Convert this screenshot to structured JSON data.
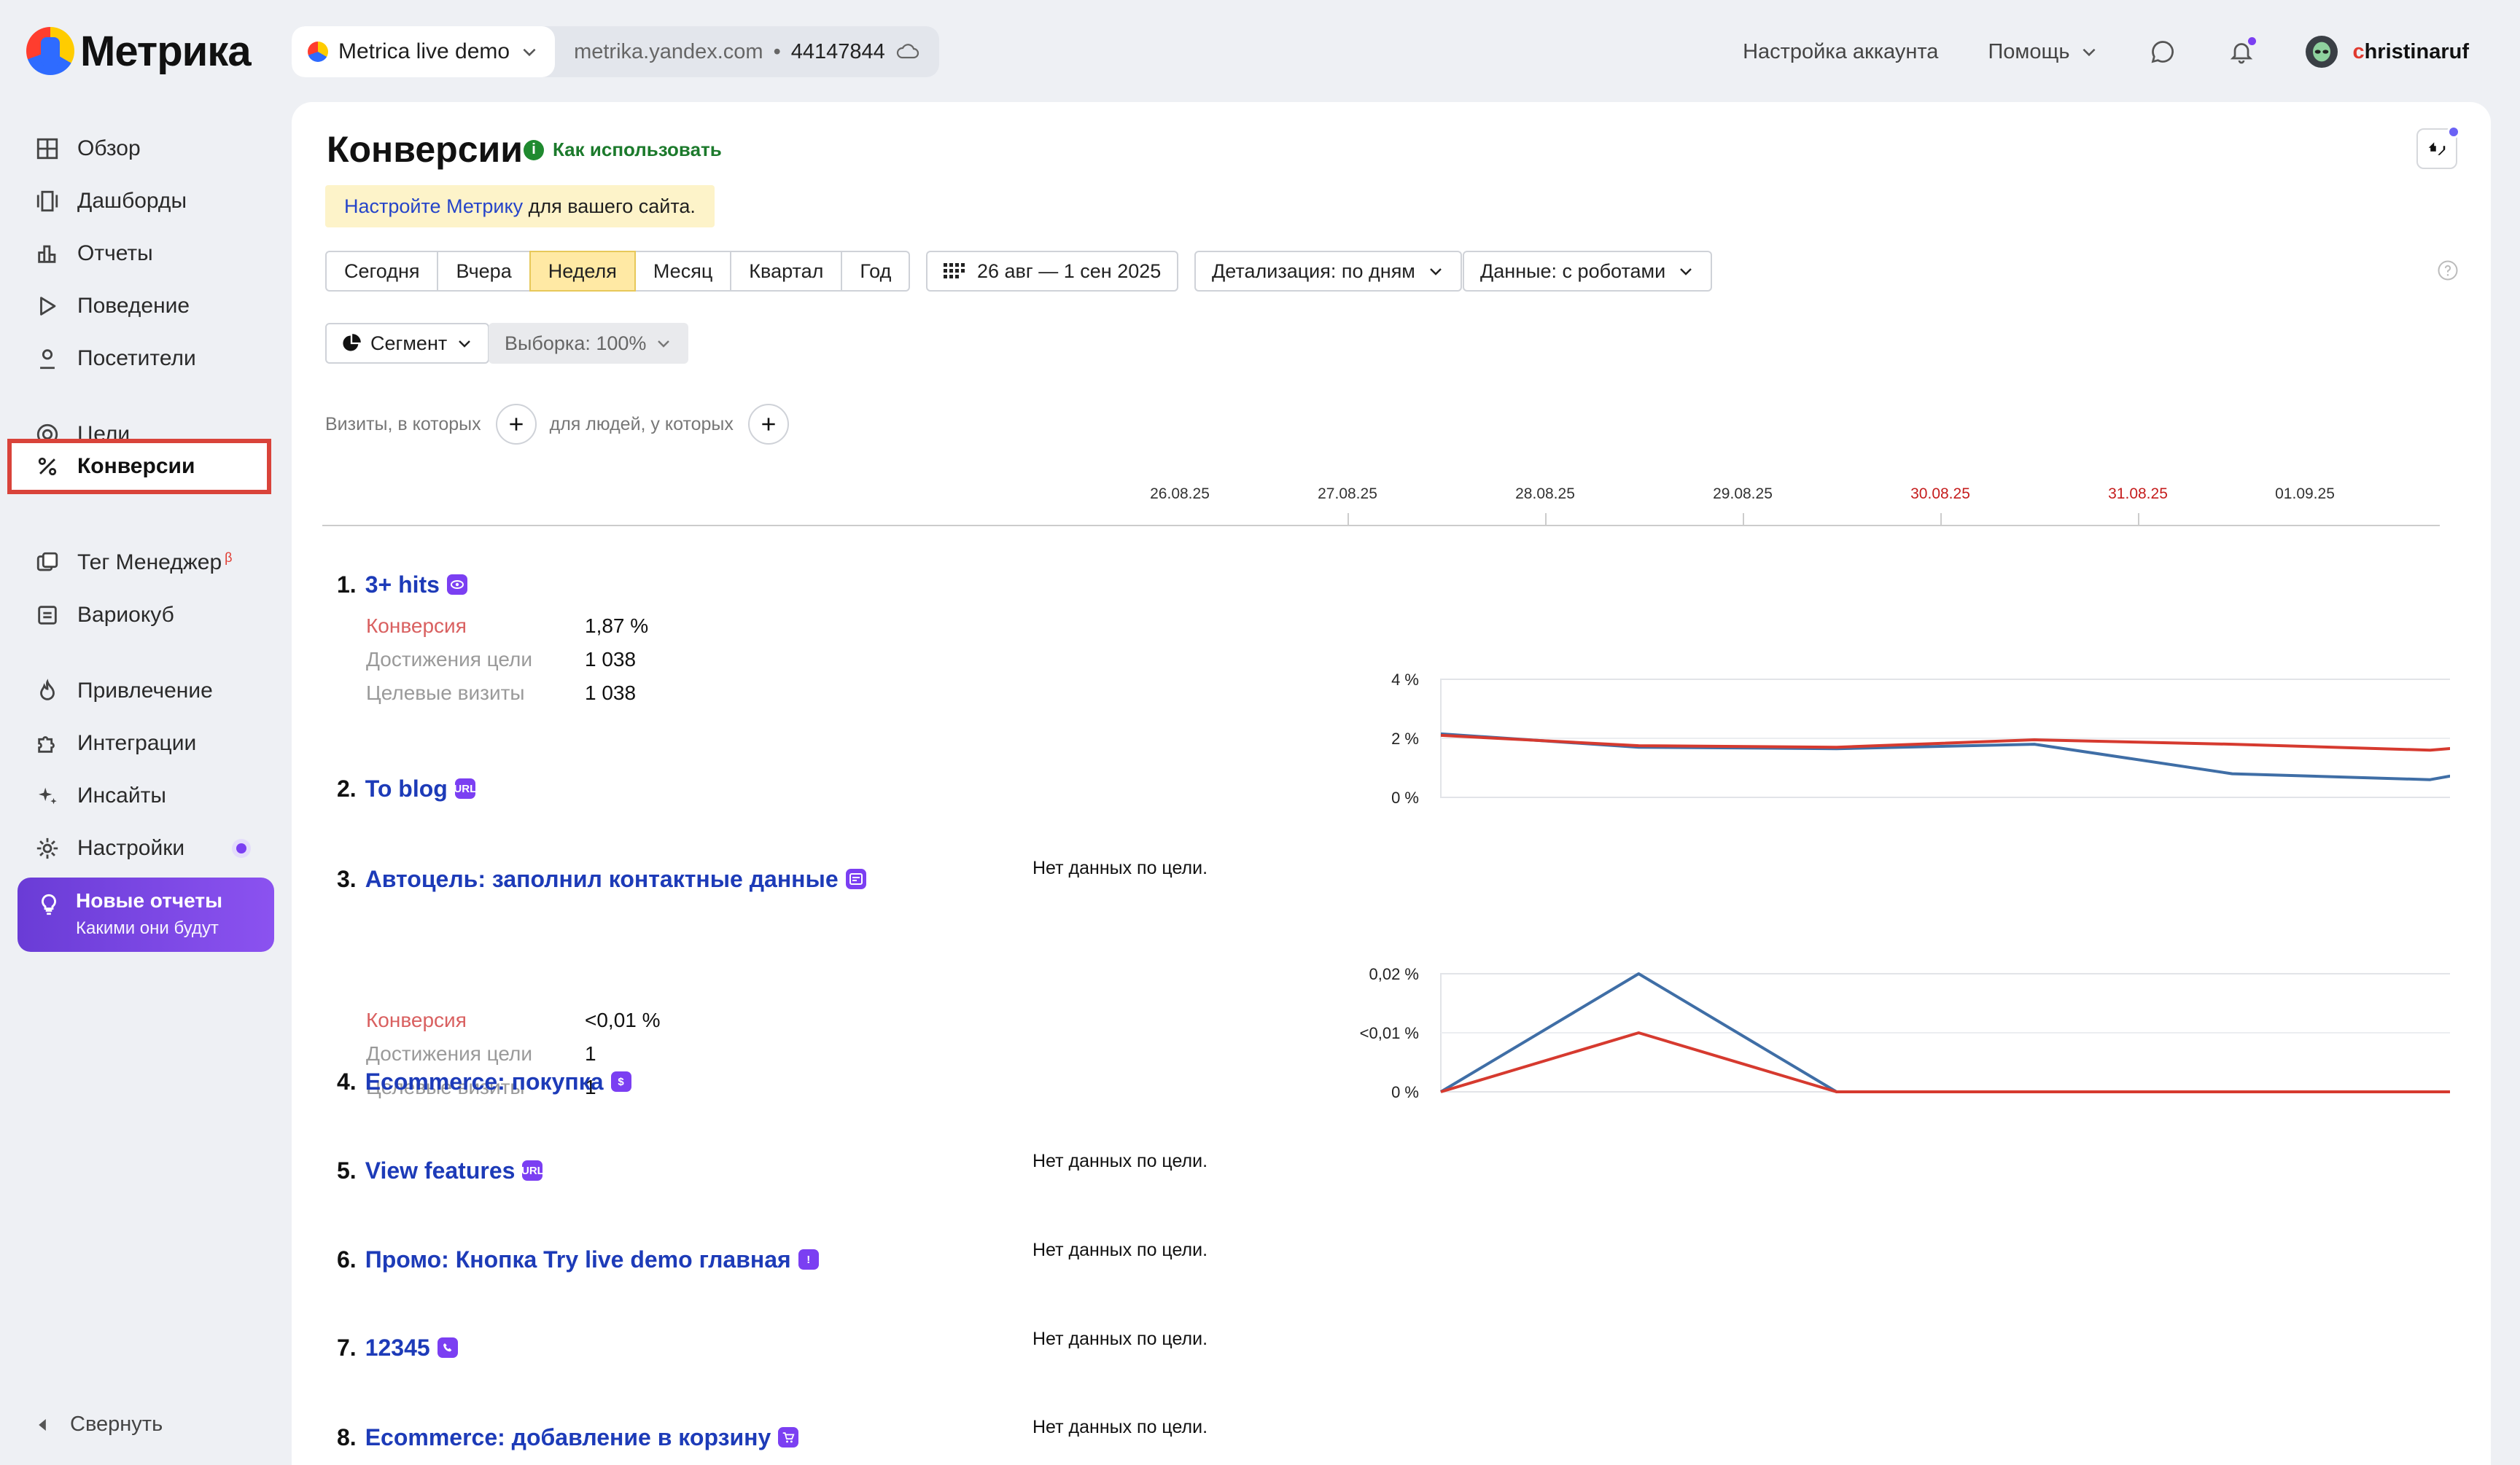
{
  "app": {
    "logo_text": "Метрика"
  },
  "counter": {
    "name": "Metrica live demo",
    "domain": "metrika.yandex.com",
    "id": "44147844"
  },
  "header": {
    "account_settings": "Настройка аккаунта",
    "help": "Помощь",
    "user_name_first": "c",
    "user_name_rest": "hristinaruf"
  },
  "sidebar": {
    "items": [
      {
        "label": "Обзор",
        "icon": "grid-icon"
      },
      {
        "label": "Дашборды",
        "icon": "dashboard-icon"
      },
      {
        "label": "Отчеты",
        "icon": "bar-chart-icon"
      },
      {
        "label": "Поведение",
        "icon": "play-icon"
      },
      {
        "label": "Посетители",
        "icon": "person-icon"
      },
      {
        "label": "Цели",
        "icon": "target-icon"
      },
      {
        "label": "Конверсии",
        "icon": "percent-icon"
      },
      {
        "label": "Тег Менеджер",
        "icon": "tag-manager-icon",
        "badge": "β"
      },
      {
        "label": "Вариокуб",
        "icon": "variocube-icon"
      },
      {
        "label": "Привлечение",
        "icon": "fire-icon"
      },
      {
        "label": "Интеграции",
        "icon": "puzzle-icon"
      },
      {
        "label": "Инсайты",
        "icon": "sparkle-icon"
      },
      {
        "label": "Настройки",
        "icon": "gear-icon"
      }
    ],
    "promo": {
      "title": "Новые отчеты",
      "subtitle": "Какими они будут"
    },
    "collapse_label": "Свернуть"
  },
  "page": {
    "title": "Конверсии",
    "how_to": "Как использовать",
    "setup_link": "Настройте Метрику",
    "setup_rest": " для вашего сайта."
  },
  "toolbar": {
    "periods": [
      "Сегодня",
      "Вчера",
      "Неделя",
      "Месяц",
      "Квартал",
      "Год"
    ],
    "selected_period": "Неделя",
    "date_range": "26 авг — 1 сен 2025",
    "detail": "Детализация: по дням",
    "data": "Данные: с роботами",
    "segment": "Сегмент",
    "sample": "Выборка: 100%",
    "visits_filter": "Визиты, в которых",
    "people_filter": "для людей, у которых"
  },
  "dates": [
    {
      "label": "26.08.25",
      "weekend": false
    },
    {
      "label": "27.08.25",
      "weekend": false
    },
    {
      "label": "28.08.25",
      "weekend": false
    },
    {
      "label": "29.08.25",
      "weekend": false
    },
    {
      "label": "30.08.25",
      "weekend": true
    },
    {
      "label": "31.08.25",
      "weekend": true
    },
    {
      "label": "01.09.25",
      "weekend": false
    }
  ],
  "metric_labels": {
    "conversion": "Конверсия",
    "reaches": "Достижения цели",
    "visits": "Целевые визиты"
  },
  "no_data_text": "Нет данных по цели.",
  "colors": {
    "conversion_line": "#d63a2f",
    "visits_line": "#3f6ea6",
    "link": "#1d3bb8",
    "badge": "#7b3ff2"
  },
  "goals": [
    {
      "num": "1.",
      "name": "3+ hits",
      "icon": "eye-badge-icon",
      "conversion": "1,87 %",
      "reaches": "1 038",
      "visits": "1 038",
      "has_chart": true
    },
    {
      "num": "2.",
      "name": "To blog",
      "icon": "url-badge-icon",
      "has_chart": false
    },
    {
      "num": "3.",
      "name": "Автоцель: заполнил контактные данные",
      "icon": "form-badge-icon",
      "conversion": "<0,01 %",
      "reaches": "1",
      "visits": "1",
      "has_chart": true
    },
    {
      "num": "4.",
      "name": "Ecommerce: покупка",
      "icon": "dollar-badge-icon",
      "has_chart": false
    },
    {
      "num": "5.",
      "name": "View features",
      "icon": "url-badge-icon",
      "has_chart": false
    },
    {
      "num": "6.",
      "name": "Промо: Кнопка Try live demo главная",
      "icon": "exclaim-badge-icon",
      "has_chart": false
    },
    {
      "num": "7.",
      "name": "12345",
      "icon": "phone-badge-icon",
      "has_chart": false
    },
    {
      "num": "8.",
      "name": "Ecommerce: добавление в корзину",
      "icon": "cart-badge-icon",
      "has_chart": false
    }
  ],
  "chart_data": [
    {
      "type": "line",
      "x": [
        "26.08.25",
        "27.08.25",
        "28.08.25",
        "29.08.25",
        "30.08.25",
        "31.08.25",
        "01.09.25"
      ],
      "y_left_ticks": [
        "4 %",
        "2 %",
        "0 %"
      ],
      "y_right_ticks": [
        "400",
        "200",
        "0"
      ],
      "ylim_left": [
        0,
        4
      ],
      "ylim_right": [
        0,
        400
      ],
      "series": [
        {
          "axis": "left",
          "color": "#d63a2f",
          "values": [
            2.1,
            1.75,
            1.7,
            1.95,
            1.8,
            1.6,
            2.15
          ]
        },
        {
          "axis": "right",
          "color": "#3f6ea6",
          "values": [
            215,
            170,
            165,
            180,
            80,
            60,
            180
          ]
        }
      ]
    },
    {
      "type": "line",
      "x": [
        "26.08.25",
        "27.08.25",
        "28.08.25",
        "29.08.25",
        "30.08.25",
        "31.08.25",
        "01.09.25"
      ],
      "y_left_ticks": [
        "0,02 %",
        "<0,01 %",
        "0 %"
      ],
      "y_right_ticks": [
        "1",
        "0,5",
        "0"
      ],
      "ylim_left": [
        0,
        0.02
      ],
      "ylim_right": [
        0,
        1
      ],
      "series": [
        {
          "axis": "left",
          "color": "#d63a2f",
          "values": [
            0,
            0.01,
            0,
            0,
            0,
            0,
            0
          ]
        },
        {
          "axis": "right",
          "color": "#3f6ea6",
          "values": [
            0,
            1,
            0,
            0,
            0,
            0,
            0
          ]
        }
      ]
    }
  ]
}
